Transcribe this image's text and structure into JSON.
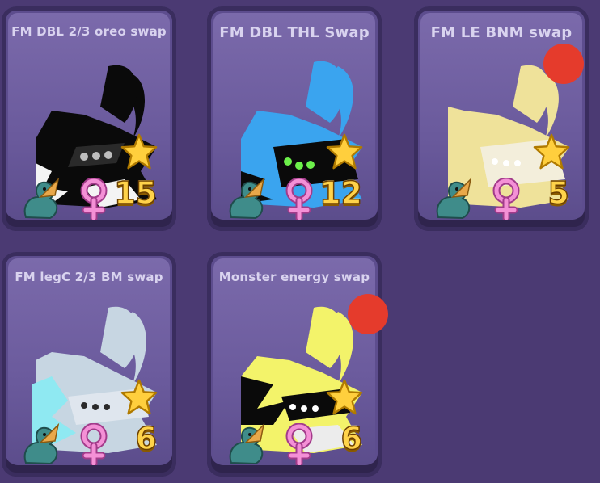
{
  "cards": [
    {
      "title": "FM DBL 2/3 oreo swap",
      "count": "15",
      "pet_colors": {
        "main": "#0a0a0a",
        "accent": "#f4f4f4",
        "eye": "#bdbdbd"
      },
      "new_badge": false,
      "title_size": "15px"
    },
    {
      "title": "FM DBL THL Swap",
      "count": "12",
      "pet_colors": {
        "main": "#3aa4ef",
        "accent": "#0a0a0a",
        "eye": "#6cf04a"
      },
      "new_badge": false,
      "title_size": "18px"
    },
    {
      "title": "FM LE BNM swap",
      "count": "5",
      "pet_colors": {
        "main": "#efe29a",
        "accent": "#f3eedb",
        "eye": "#ffffff"
      },
      "new_badge": true,
      "title_size": "18px"
    },
    {
      "title": "FM legC 2/3 BM swap",
      "count": "6",
      "pet_colors": {
        "main": "#c7d6e2",
        "accent": "#8fe9f2",
        "eye": "#f2f2f2"
      },
      "new_badge": false,
      "title_size": "15px"
    },
    {
      "title": "Monster energy swap",
      "count": "6",
      "pet_colors": {
        "main": "#f3f36a",
        "accent": "#0a0a0a",
        "eye": "#ffffff"
      },
      "new_badge": true,
      "title_size": "15px"
    }
  ],
  "icons": {
    "star": "star-icon",
    "dragon": "dragon-icon",
    "female": "female-icon"
  },
  "colors": {
    "background": "#4b3a73",
    "count": "#ffd34a",
    "badge": "#e53b2c"
  }
}
